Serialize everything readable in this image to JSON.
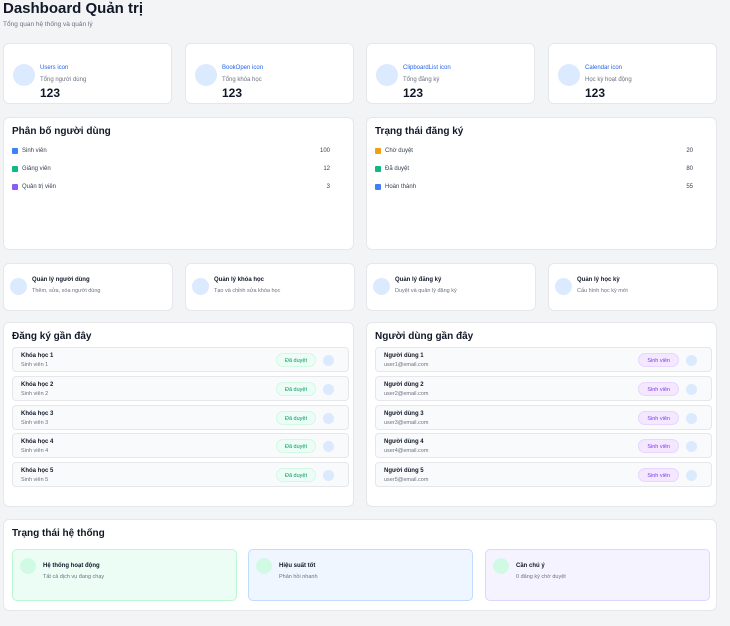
{
  "header": {
    "title": "Dashboard Quản trị",
    "subtitle": "Tổng quan hệ thống và quản lý"
  },
  "stats": [
    {
      "icon": "Users icon",
      "label": "Tổng người dùng",
      "value": "123"
    },
    {
      "icon": "BookOpen icon",
      "label": "Tổng khóa học",
      "value": "123"
    },
    {
      "icon": "ClipboardList icon",
      "label": "Tổng đăng ký",
      "value": "123"
    },
    {
      "icon": "Calendar icon",
      "label": "Học kỳ hoạt động",
      "value": "123"
    }
  ],
  "user_distribution": {
    "title": "Phân bố người dùng",
    "rows": [
      {
        "label": "Sinh viên",
        "value": "100",
        "color": "#3b82f6"
      },
      {
        "label": "Giảng viên",
        "value": "12",
        "color": "#10b981"
      },
      {
        "label": "Quản trị viên",
        "value": "3",
        "color": "#8b5cf6"
      }
    ]
  },
  "enrollment_status": {
    "title": "Trạng thái đăng ký",
    "rows": [
      {
        "label": "Chờ duyệt",
        "value": "20",
        "color": "#f59e0b"
      },
      {
        "label": "Đã duyệt",
        "value": "80",
        "color": "#10b981"
      },
      {
        "label": "Hoàn thành",
        "value": "55",
        "color": "#3b82f6"
      }
    ]
  },
  "actions": [
    {
      "title": "Quản lý người dùng",
      "desc": "Thêm, sửa, xóa người dùng"
    },
    {
      "title": "Quản lý khóa học",
      "desc": "Tạo và chỉnh sửa khóa học"
    },
    {
      "title": "Quản lý đăng ký",
      "desc": "Duyệt và quản lý đăng ký"
    },
    {
      "title": "Quản lý học kỳ",
      "desc": "Cấu hình học kỳ mới"
    }
  ],
  "recent_enrollments": {
    "title": "Đăng ký gần đây",
    "items": [
      {
        "title": "Khóa học 1",
        "sub": "Sinh viên 1",
        "badge": "Đã duyệt"
      },
      {
        "title": "Khóa học 2",
        "sub": "Sinh viên 2",
        "badge": "Đã duyệt"
      },
      {
        "title": "Khóa học 3",
        "sub": "Sinh viên 3",
        "badge": "Đã duyệt"
      },
      {
        "title": "Khóa học 4",
        "sub": "Sinh viên 4",
        "badge": "Đã duyệt"
      },
      {
        "title": "Khóa học 5",
        "sub": "Sinh viên 5",
        "badge": "Đã duyệt"
      }
    ]
  },
  "recent_users": {
    "title": "Người dùng gần đây",
    "items": [
      {
        "title": "Người dùng 1",
        "sub": "user1@email.com",
        "badge": "Sinh viên"
      },
      {
        "title": "Người dùng 2",
        "sub": "user2@email.com",
        "badge": "Sinh viên"
      },
      {
        "title": "Người dùng 3",
        "sub": "user3@email.com",
        "badge": "Sinh viên"
      },
      {
        "title": "Người dùng 4",
        "sub": "user4@email.com",
        "badge": "Sinh viên"
      },
      {
        "title": "Người dùng 5",
        "sub": "user5@email.com",
        "badge": "Sinh viên"
      }
    ]
  },
  "system_status": {
    "title": "Trạng thái hệ thống",
    "boxes": [
      {
        "title": "Hệ thống hoạt động",
        "desc": "Tất cả dịch vụ đang chạy"
      },
      {
        "title": "Hiệu suất tốt",
        "desc": "Phản hồi nhanh"
      },
      {
        "title": "Cần chú ý",
        "desc": "0 đăng ký chờ duyệt"
      }
    ]
  }
}
